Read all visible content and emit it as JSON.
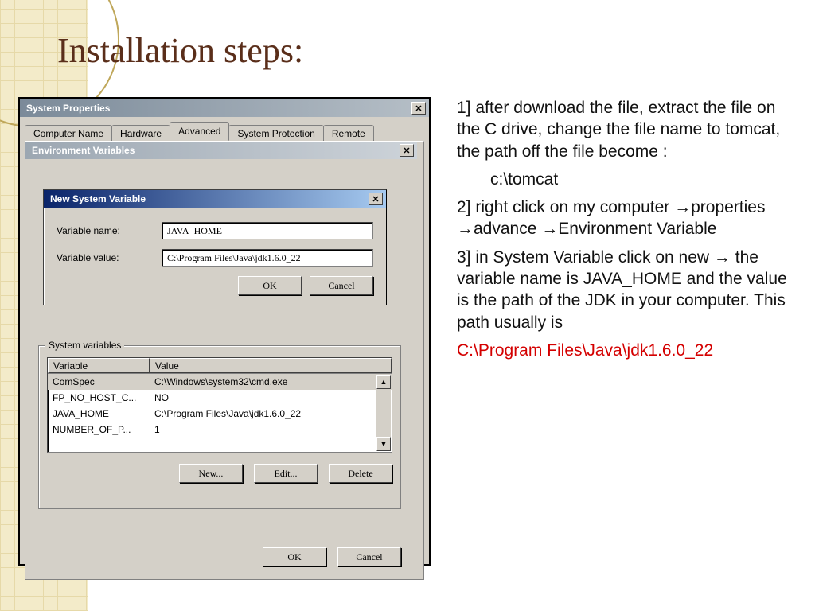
{
  "slide": {
    "title": "Installation steps:"
  },
  "text": {
    "step1": "1] after download the file, extract the file on the C drive, change the file name to tomcat, the path off the file become :",
    "step1_path": "c:\\tomcat",
    "step2": "2] right click on my computer →properties  →advance →Environment Variable",
    "step3": "3] in System Variable click on new → the variable name is JAVA_HOME and the value is the path of the JDK in your computer. This path usually is",
    "jdk_path": "C:\\Program Files\\Java\\jdk1.6.0_22"
  },
  "sysprops": {
    "title": "System Properties",
    "tabs": [
      "Computer Name",
      "Hardware",
      "Advanced",
      "System Protection",
      "Remote"
    ],
    "active_tab": 2
  },
  "envdlg": {
    "title": "Environment Variables",
    "group_label": "System variables",
    "col_variable": "Variable",
    "col_value": "Value",
    "rows": [
      {
        "var": "ComSpec",
        "val": "C:\\Windows\\system32\\cmd.exe",
        "selected": true
      },
      {
        "var": "FP_NO_HOST_C...",
        "val": "NO",
        "selected": false
      },
      {
        "var": "JAVA_HOME",
        "val": "C:\\Program Files\\Java\\jdk1.6.0_22",
        "selected": false
      },
      {
        "var": "NUMBER_OF_P...",
        "val": "1",
        "selected": false
      }
    ],
    "btn_new": "New...",
    "btn_edit": "Edit...",
    "btn_delete": "Delete",
    "btn_ok": "OK",
    "btn_cancel": "Cancel"
  },
  "nsv": {
    "title": "New System Variable",
    "label_name": "Variable name:",
    "label_value": "Variable value:",
    "value_name": "JAVA_HOME",
    "value_value": "C:\\Program Files\\Java\\jdk1.6.0_22",
    "btn_ok": "OK",
    "btn_cancel": "Cancel"
  },
  "icons": {
    "close": "✕",
    "up": "▲",
    "down": "▼"
  }
}
